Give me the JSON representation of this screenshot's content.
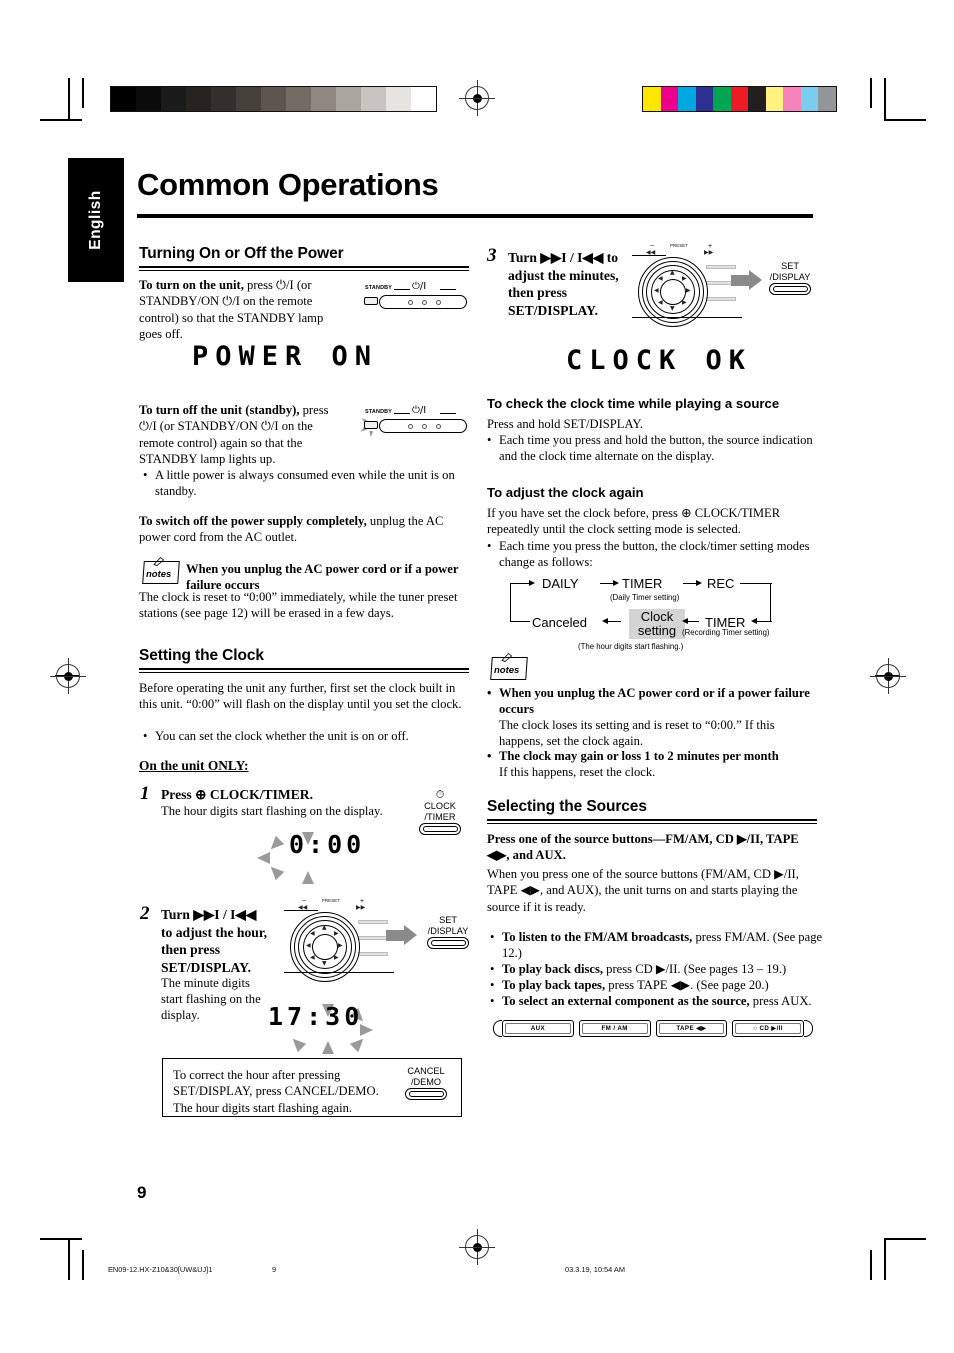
{
  "document": {
    "language_tab": "English",
    "page_title": "Common Operations",
    "page_number": "9"
  },
  "left_column": {
    "section1": {
      "heading": "Turning On or Off the Power",
      "para1_bold": "To turn on the unit,",
      "para1_rest": " press ⏻/I (or STANDBY/ON ⏻/I on the remote control) so that the STANDBY lamp goes off.",
      "lcd1": "POWER ON",
      "para2_bold": "To turn off the unit (standby),",
      "para2_rest": " press ⏻/I (or STANDBY/ON ⏻/I on the remote control) again so that the STANDBY lamp lights up.",
      "bullet1": "A little power is always consumed even while the unit is on standby.",
      "para3_bold": "To switch off the power supply completely,",
      "para3_rest": " unplug the AC power cord from the AC outlet.",
      "note_title": "When you unplug the AC power cord or if a power failure occurs",
      "note_body": "The clock is reset to “0:00” immediately, while the tuner preset stations (see page 12) will be erased in a few days.",
      "illustration1": {
        "standby_label": "STANDBY",
        "power_symbol": "⏻/I"
      },
      "illustration2": {
        "standby_label": "STANDBY",
        "power_symbol": "⏻/I"
      }
    },
    "section2": {
      "heading": "Setting the Clock",
      "intro": "Before operating the unit any further, first set the clock built in this unit. “0:00” will flash on the display until you set the clock.",
      "bullet1": "You can set the clock whether the unit is on or off.",
      "only_head": "On the unit ONLY:",
      "step1": {
        "num": "1",
        "title": "Press ⊕ CLOCK/TIMER.",
        "desc": "The hour digits start flashing on the display.",
        "lcd": "0:00",
        "button_caption": "CLOCK\n/TIMER"
      },
      "step2": {
        "num": "2",
        "title": "Turn ▶▶I / I◀◀ to adjust the hour, then press SET/DISPLAY.",
        "desc": "The minute digits start flashing on the display.",
        "lcd": "17:30",
        "button_caption": "SET\n/DISPLAY"
      },
      "tip_box": {
        "text": "To correct the hour after pressing SET/DISPLAY, press CANCEL/DEMO. The hour digits start flashing again.",
        "button_caption": "CANCEL\n/DEMO"
      }
    }
  },
  "right_column": {
    "step3": {
      "num": "3",
      "title": "Turn ▶▶I / I◀◀ to adjust the minutes, then press SET/DISPLAY.",
      "lcd": "CLOCK OK",
      "button_caption": "SET\n/DISPLAY"
    },
    "check_clock": {
      "heading": "To check the clock time while playing a source",
      "line1": "Press and hold SET/DISPLAY.",
      "bullet1": "Each time you press and hold the button, the source indication and the clock time alternate on the display."
    },
    "adjust_again": {
      "heading": "To adjust the clock again",
      "line1": "If you have set the clock before, press ⊕ CLOCK/TIMER repeatedly until the clock setting mode is selected.",
      "bullet1": "Each time you press the button, the clock/timer setting modes change as follows:"
    },
    "flow": {
      "daily": "DAILY",
      "timer_top": "TIMER",
      "rec": "REC",
      "timer_bottom": "TIMER",
      "clock_setting": "Clock\nsetting",
      "canceled": "Canceled",
      "note_daily": "(Daily Timer setting)",
      "note_rec": "(Recording Timer setting)",
      "note_hour": "(The hour digits start flashing.)",
      "highlight_color": "#d4d4d4"
    },
    "notes": {
      "note1_title": "When you unplug the AC power cord or if a power failure occurs",
      "note1_body": "The clock loses its setting and is reset to “0:00.” If this happens, set the clock again.",
      "note2_title": "The clock may gain or loss 1 to 2 minutes per month",
      "note2_body": "If this happens, reset the clock."
    },
    "sources": {
      "heading": "Selecting the Sources",
      "lead": "Press one of the source buttons—FM/AM, CD ▶/II, TAPE ◀▶, and AUX.",
      "para": "When you press one of the source buttons (FM/AM, CD ▶/II, TAPE ◀▶, and AUX), the unit turns on and starts playing the source if it is ready.",
      "bullet1_bold": "To listen to the FM/AM broadcasts,",
      "bullet1_rest": " press FM/AM. (See page 12.)",
      "bullet2_bold": "To play back discs,",
      "bullet2_rest": " press CD ▶/II. (See pages 13 – 19.)",
      "bullet3_bold": "To play back tapes,",
      "bullet3_rest": " press TAPE ◀▶. (See page 20.)",
      "bullet4_bold": "To select an external component as the source,",
      "bullet4_rest": " press AUX.",
      "buttons": [
        "AUX",
        "FM / AM",
        "TAPE  ◀▶",
        "○  CD ▶/II"
      ]
    }
  },
  "footer": {
    "file_id": "EN09-12.HX-Z10&30[UW&UJ]1",
    "page_num": "9",
    "timestamp": "03.3.19, 10:54 AM"
  },
  "print_marks": {
    "gray_scale": [
      "#000000",
      "#0b0b0b",
      "#1a1a1a",
      "#262321",
      "#33302c",
      "#454039",
      "#5c564e",
      "#736c63",
      "#8e8880",
      "#a9a49d",
      "#c8c4bf",
      "#e6e4e1",
      "#ffffff"
    ],
    "color_bar": [
      "#ffe600",
      "#ec008c",
      "#00a7e1",
      "#2e3192",
      "#00a651",
      "#ed1c24",
      "#231f20",
      "#fff282",
      "#f783bd",
      "#7bcdf0",
      "#939598"
    ]
  }
}
